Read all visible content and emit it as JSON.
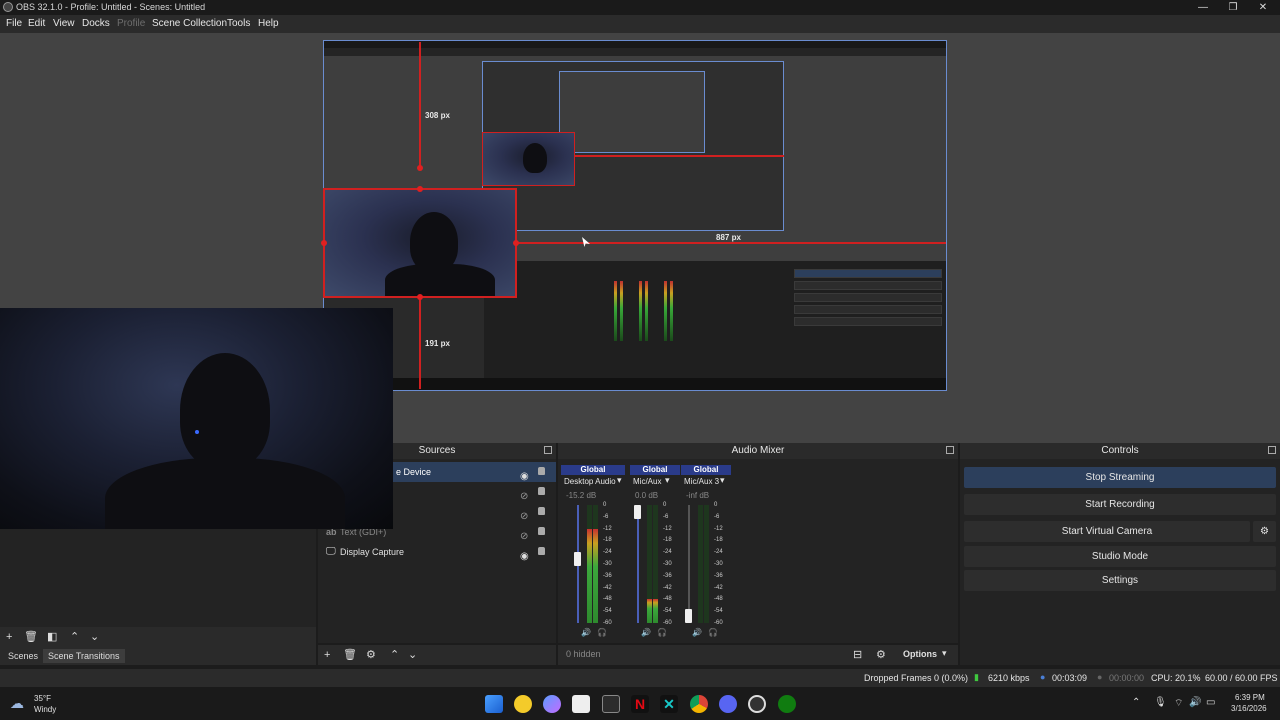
{
  "window": {
    "title": "OBS 32.1.0 - Profile: Untitled - Scenes: Untitled",
    "minimize": "—",
    "restore": "❐",
    "close": "✕"
  },
  "menu": [
    "File",
    "Edit",
    "View",
    "Docks",
    "Profile",
    "Scene Collection",
    "Tools",
    "Help"
  ],
  "preview": {
    "measure_top": "308 px",
    "measure_right": "887 px",
    "measure_bottom": "191 px"
  },
  "scenes": {
    "toolbar_icons": [
      "add-icon",
      "trash-icon",
      "filter-icon",
      "arrow-up-icon",
      "arrow-down-icon"
    ],
    "tabs": [
      "Scenes",
      "Scene Transitions"
    ]
  },
  "sources": {
    "header": "Sources",
    "items": [
      {
        "name": "Video Capture Device",
        "visible_label": "e Device",
        "selected": true,
        "visible": true
      },
      {
        "name": "",
        "visible": false
      },
      {
        "name": "",
        "visible": false
      },
      {
        "name": "Text (GDI+)",
        "visible": false
      },
      {
        "name": "Display Capture",
        "visible": true
      }
    ]
  },
  "audio_mixer": {
    "header": "Audio Mixer",
    "global_label": "Global",
    "channels": [
      {
        "name": "Desktop Audio",
        "db": "-15.2 dB",
        "level": 0.55,
        "meter": 0.8
      },
      {
        "name": "Mic/Aux",
        "db": "0.0 dB",
        "level": 1.0,
        "meter": 0.2
      },
      {
        "name": "Mic/Aux 3",
        "db": "-inf dB",
        "level": 0.0,
        "meter": 0.0
      }
    ],
    "ticks": [
      "0",
      "-6",
      "-12",
      "-18",
      "-24",
      "-30",
      "-36",
      "-42",
      "-48",
      "-54",
      "-60"
    ],
    "hidden": "0 hidden",
    "options": "Options"
  },
  "controls": {
    "header": "Controls",
    "stop_streaming": "Stop Streaming",
    "start_recording": "Start Recording",
    "start_virtual_camera": "Start Virtual Camera",
    "studio_mode": "Studio Mode",
    "settings": "Settings"
  },
  "status": {
    "dropped_frames": "Dropped Frames 0 (0.0%)",
    "bitrate": "6210 kbps",
    "stream_time": "00:03:09",
    "rec_time": "00:00:00",
    "cpu": "CPU: 20.1%",
    "fps": "60.00 / 60.00 FPS"
  },
  "taskbar": {
    "weather_temp": "35°F",
    "weather_desc": "Windy",
    "time": "6:39 PM",
    "date": "3/16/2026"
  },
  "colors": {
    "accent": "#2c3f5c",
    "guide_red": "#d02020",
    "selection_blue": "#6a8cd0",
    "global_btn": "#2a3b8a"
  }
}
